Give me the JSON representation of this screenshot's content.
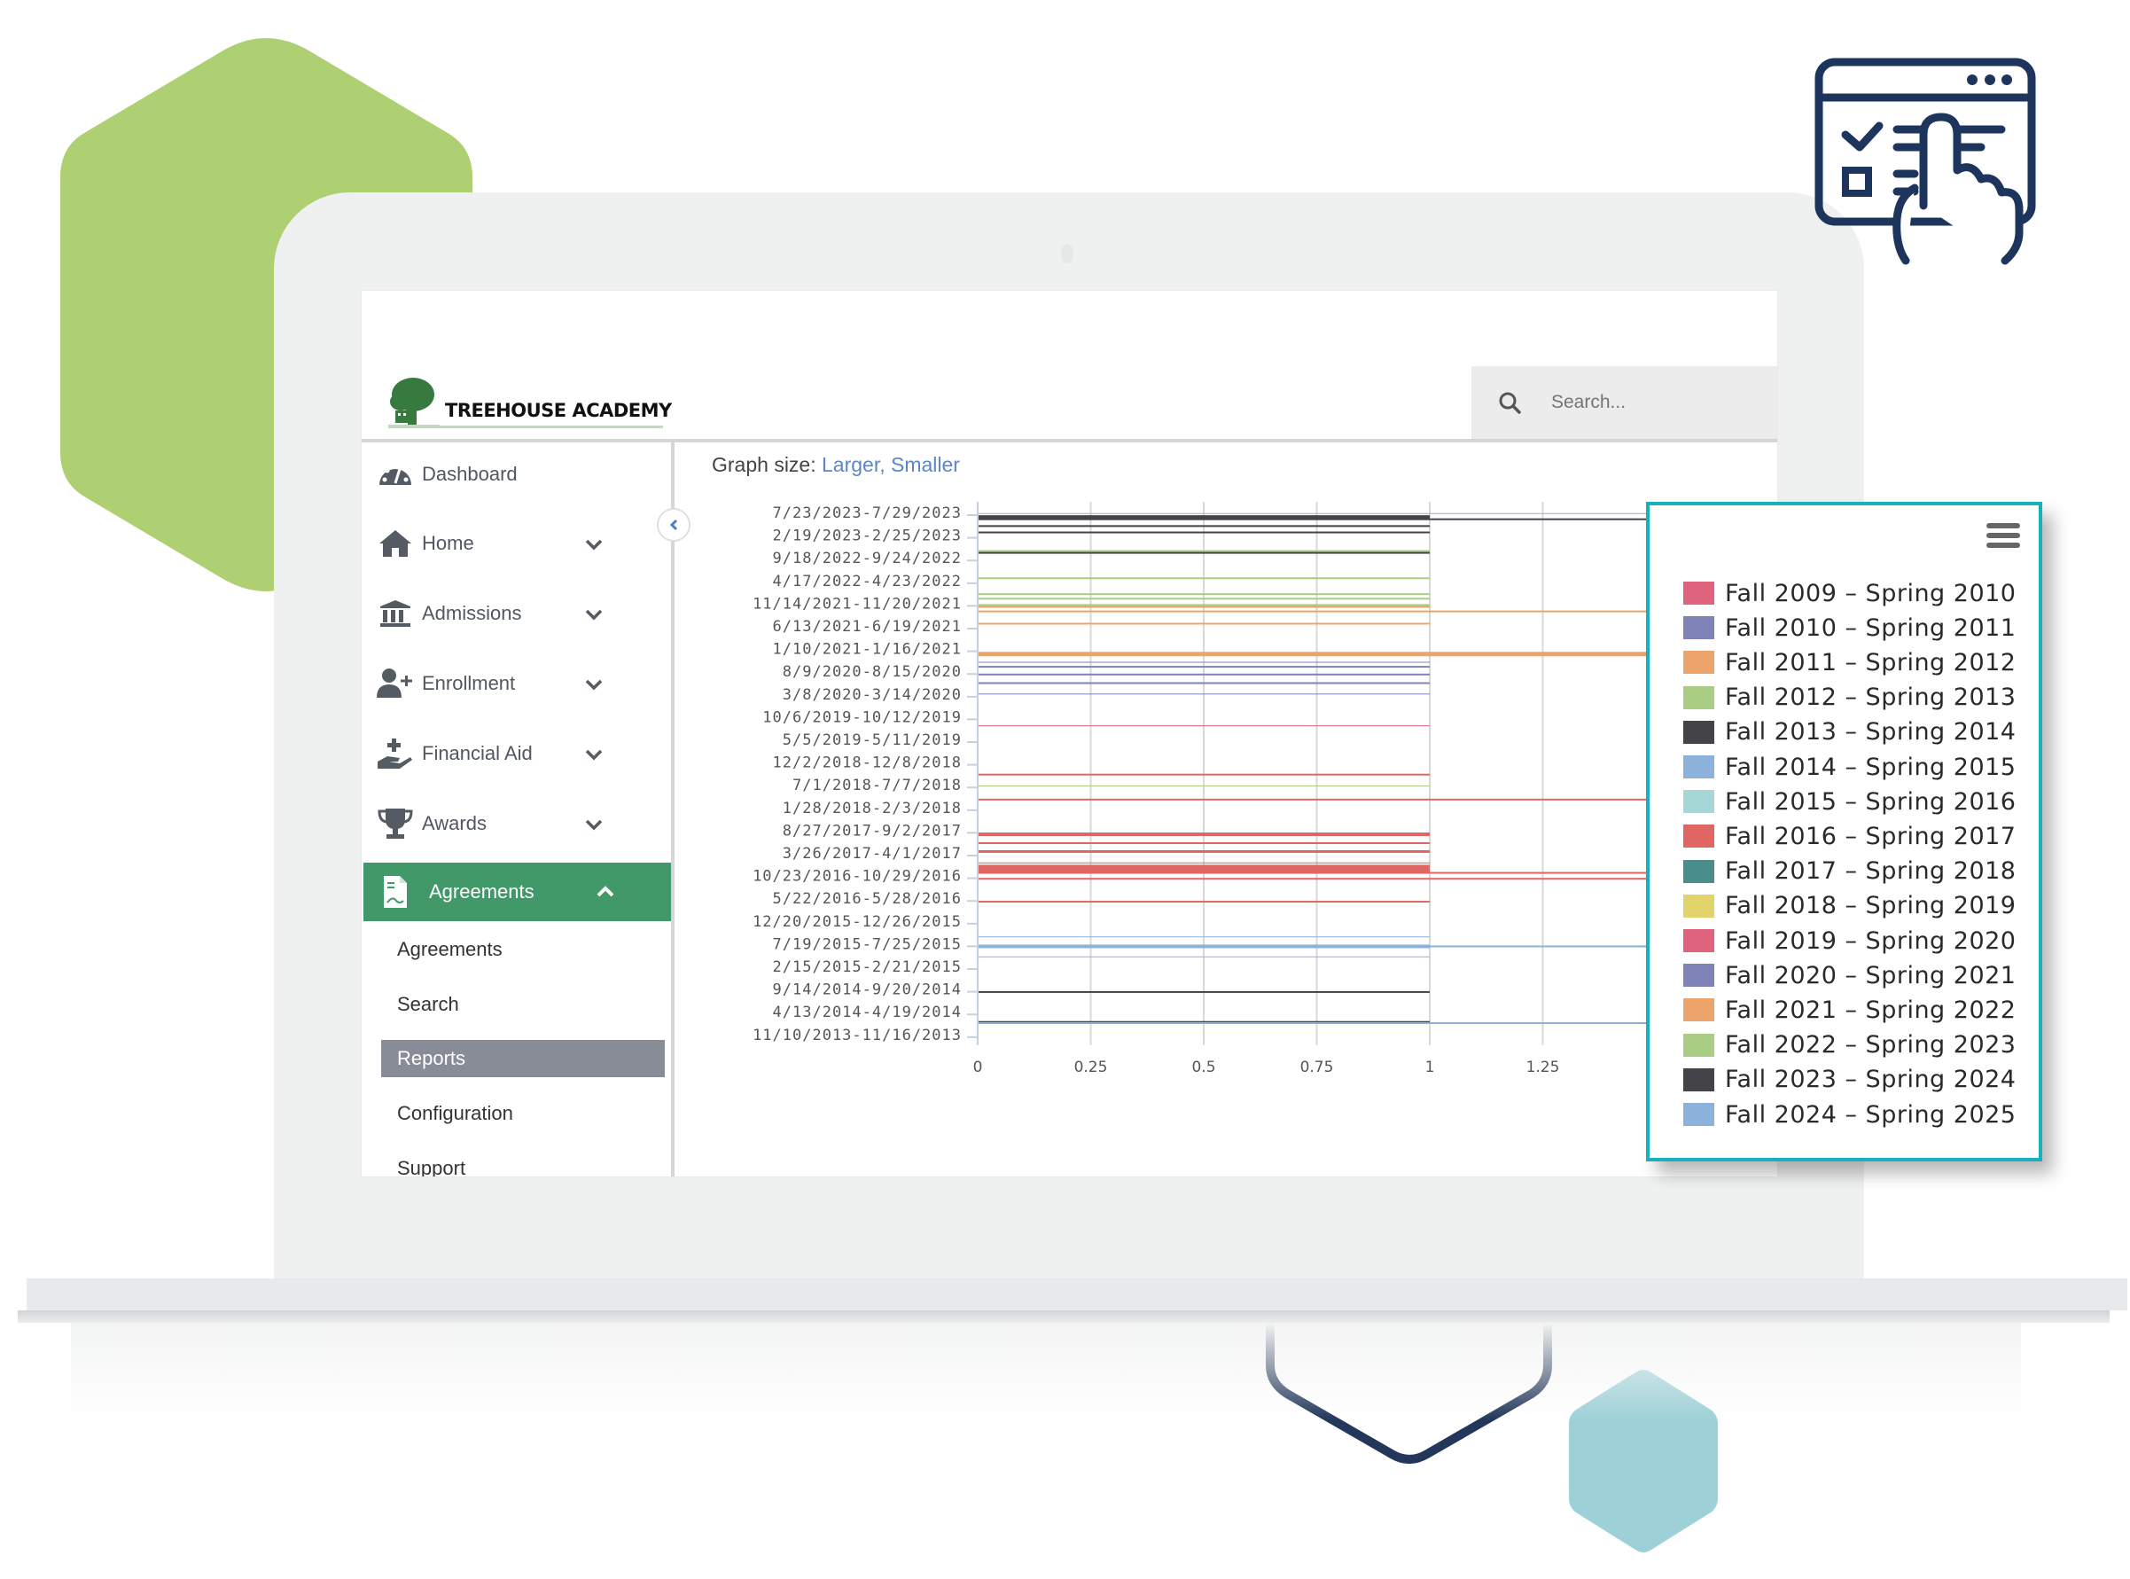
{
  "brand": {
    "name": "TREEHOUSE ACADEMY",
    "accent_green": "#419868",
    "navy": "#1f355c",
    "hex_green": "#aed072",
    "hex_teal": "#9dd1d7",
    "legend_border": "#16b1bd"
  },
  "search": {
    "placeholder": "Search..."
  },
  "sidebar": {
    "items": [
      {
        "label": "Dashboard",
        "icon": "dashboard-gauge-icon",
        "expandable": false
      },
      {
        "label": "Home",
        "icon": "home-icon",
        "expandable": true
      },
      {
        "label": "Admissions",
        "icon": "bank-building-icon",
        "expandable": true
      },
      {
        "label": "Enrollment",
        "icon": "user-plus-icon",
        "expandable": true
      },
      {
        "label": "Financial Aid",
        "icon": "hand-holding-plus-icon",
        "expandable": true
      },
      {
        "label": "Awards",
        "icon": "trophy-icon",
        "expandable": true
      },
      {
        "label": "Agreements",
        "icon": "document-pdf-icon",
        "expandable": true,
        "expanded": true,
        "active": true
      }
    ],
    "subitems": [
      {
        "label": "Agreements",
        "active": false
      },
      {
        "label": "Search",
        "active": false
      },
      {
        "label": "Reports",
        "active": true
      },
      {
        "label": "Configuration",
        "active": false
      },
      {
        "label": "Support",
        "active": false
      }
    ],
    "collapse_icon": "chevron-left-icon"
  },
  "graph_controls": {
    "label": "Graph size:",
    "larger": "Larger",
    "separator": ",",
    "smaller": "Smaller"
  },
  "chart_data": {
    "type": "bar",
    "orientation": "horizontal",
    "title": "",
    "xlabel": "",
    "ylabel": "",
    "xlim": [
      0,
      1.5
    ],
    "x_ticks": [
      "0",
      "0.25",
      "0.5",
      "0.75",
      "1",
      "1.25"
    ],
    "grid": true,
    "legend_position": "right (overlay panel)",
    "y_tick_labels": [
      "7/23/2023-7/29/2023",
      "2/19/2023-2/25/2023",
      "9/18/2022-9/24/2022",
      "4/17/2022-4/23/2022",
      "11/14/2021-11/20/2021",
      "6/13/2021-6/19/2021",
      "1/10/2021-1/16/2021",
      "8/9/2020-8/15/2020",
      "3/8/2020-3/14/2020",
      "10/6/2019-10/12/2019",
      "5/5/2019-5/11/2019",
      "12/2/2018-12/8/2018",
      "7/1/2018-7/7/2018",
      "1/28/2018-2/3/2018",
      "8/27/2017-9/2/2017",
      "3/26/2017-4/1/2017",
      "10/23/2016-10/29/2016",
      "5/22/2016-5/28/2016",
      "12/20/2015-12/26/2015",
      "7/19/2015-7/25/2015",
      "2/15/2015-2/21/2015",
      "9/14/2014-9/20/2014",
      "4/13/2014-4/19/2014",
      "11/10/2013-11/16/2013"
    ],
    "series": [
      {
        "name": "Fall 2009 – Spring 2010",
        "color": "#e0637e"
      },
      {
        "name": "Fall 2010 – Spring 2011",
        "color": "#8083b7"
      },
      {
        "name": "Fall 2011 – Spring 2012",
        "color": "#eda46a"
      },
      {
        "name": "Fall 2012 – Spring 2013",
        "color": "#a9cd83"
      },
      {
        "name": "Fall 2013 – Spring 2014",
        "color": "#434348"
      },
      {
        "name": "Fall 2014 – Spring 2015",
        "color": "#8cb1db"
      },
      {
        "name": "Fall 2015 – Spring 2016",
        "color": "#a7d6d6"
      },
      {
        "name": "Fall 2016 – Spring 2017",
        "color": "#e06664"
      },
      {
        "name": "Fall 2017 – Spring 2018",
        "color": "#4a8d8b"
      },
      {
        "name": "Fall 2018 – Spring 2019",
        "color": "#e2d46a"
      },
      {
        "name": "Fall 2019 – Spring 2020",
        "color": "#e0637e"
      },
      {
        "name": "Fall 2020 – Spring 2021",
        "color": "#8083b7"
      },
      {
        "name": "Fall 2021 – Spring 2022",
        "color": "#eda46a"
      },
      {
        "name": "Fall 2022 – Spring 2023",
        "color": "#a9cd83"
      },
      {
        "name": "Fall 2023 – Spring 2024",
        "color": "#434348"
      },
      {
        "name": "Fall 2024 – Spring 2025",
        "color": "#8cb1db"
      }
    ],
    "bars": [
      {
        "pos": 23.95,
        "value": 1.5,
        "color": "#8cb1db",
        "weight": 1
      },
      {
        "pos": 23.8,
        "value": 1,
        "color": "#434348",
        "weight": 4
      },
      {
        "pos": 23.7,
        "value": 1.5,
        "color": "#434348",
        "weight": 2
      },
      {
        "pos": 23.4,
        "value": 1,
        "color": "#434348",
        "weight": 2
      },
      {
        "pos": 23.12,
        "value": 1,
        "color": "#434348",
        "weight": 2
      },
      {
        "pos": 22.3,
        "value": 1,
        "color": "#a9cd83",
        "weight": 2
      },
      {
        "pos": 22.22,
        "value": 1,
        "color": "#434348",
        "weight": 2
      },
      {
        "pos": 21.1,
        "value": 1,
        "color": "#a9cd83",
        "weight": 2
      },
      {
        "pos": 20.4,
        "value": 1,
        "color": "#a9cd83",
        "weight": 2
      },
      {
        "pos": 20.2,
        "value": 1,
        "color": "#a9cd83",
        "weight": 2
      },
      {
        "pos": 19.92,
        "value": 1,
        "color": "#a9cd83",
        "weight": 2
      },
      {
        "pos": 19.84,
        "value": 1,
        "color": "#eda46a",
        "weight": 2
      },
      {
        "pos": 19.64,
        "value": 1.5,
        "color": "#eda46a",
        "weight": 2
      },
      {
        "pos": 19.1,
        "value": 1,
        "color": "#eda46a",
        "weight": 2
      },
      {
        "pos": 17.76,
        "value": 1.5,
        "color": "#eda46a",
        "weight": 5
      },
      {
        "pos": 17.4,
        "value": 1,
        "color": "#8083b7",
        "weight": 1
      },
      {
        "pos": 17.2,
        "value": 1,
        "color": "#8083b7",
        "weight": 2
      },
      {
        "pos": 16.86,
        "value": 1,
        "color": "#8083b7",
        "weight": 2
      },
      {
        "pos": 16.48,
        "value": 1,
        "color": "#8083b7",
        "weight": 2
      },
      {
        "pos": 16.0,
        "value": 1,
        "color": "#8083b7",
        "weight": 1
      },
      {
        "pos": 14.6,
        "value": 1,
        "color": "#e0637e",
        "weight": 1
      },
      {
        "pos": 12.45,
        "value": 1,
        "color": "#e06664",
        "weight": 2
      },
      {
        "pos": 11.95,
        "value": 1,
        "color": "#a9cd83",
        "weight": 1
      },
      {
        "pos": 11.35,
        "value": 1.5,
        "color": "#e06664",
        "weight": 2
      },
      {
        "pos": 9.82,
        "value": 1,
        "color": "#e06664",
        "weight": 4
      },
      {
        "pos": 9.43,
        "value": 1,
        "color": "#e06664",
        "weight": 2
      },
      {
        "pos": 9.06,
        "value": 1,
        "color": "#e06664",
        "weight": 3
      },
      {
        "pos": 8.56,
        "value": 1,
        "color": "#e06664",
        "weight": 1
      },
      {
        "pos": 8.3,
        "value": 1,
        "color": "#e06664",
        "weight": 9
      },
      {
        "pos": 8.12,
        "value": 1.5,
        "color": "#e06664",
        "weight": 2
      },
      {
        "pos": 7.86,
        "value": 1.5,
        "color": "#e06664",
        "weight": 2
      },
      {
        "pos": 6.85,
        "value": 1,
        "color": "#e06664",
        "weight": 2
      },
      {
        "pos": 5.3,
        "value": 1,
        "color": "#8cb1db",
        "weight": 1
      },
      {
        "pos": 4.88,
        "value": 1,
        "color": "#8cb1db",
        "weight": 4
      },
      {
        "pos": 4.88,
        "value": 1.5,
        "color": "#8cb1db",
        "weight": 2
      },
      {
        "pos": 4.42,
        "value": 1,
        "color": "#8cb1db",
        "weight": 1
      },
      {
        "pos": 2.87,
        "value": 1,
        "color": "#434348",
        "weight": 2
      },
      {
        "pos": 1.55,
        "value": 1,
        "color": "#434348",
        "weight": 2
      },
      {
        "pos": 1.5,
        "value": 1.5,
        "color": "#8cb1db",
        "weight": 2
      }
    ]
  },
  "legend": {
    "menu_icon": "hamburger-menu-icon"
  }
}
